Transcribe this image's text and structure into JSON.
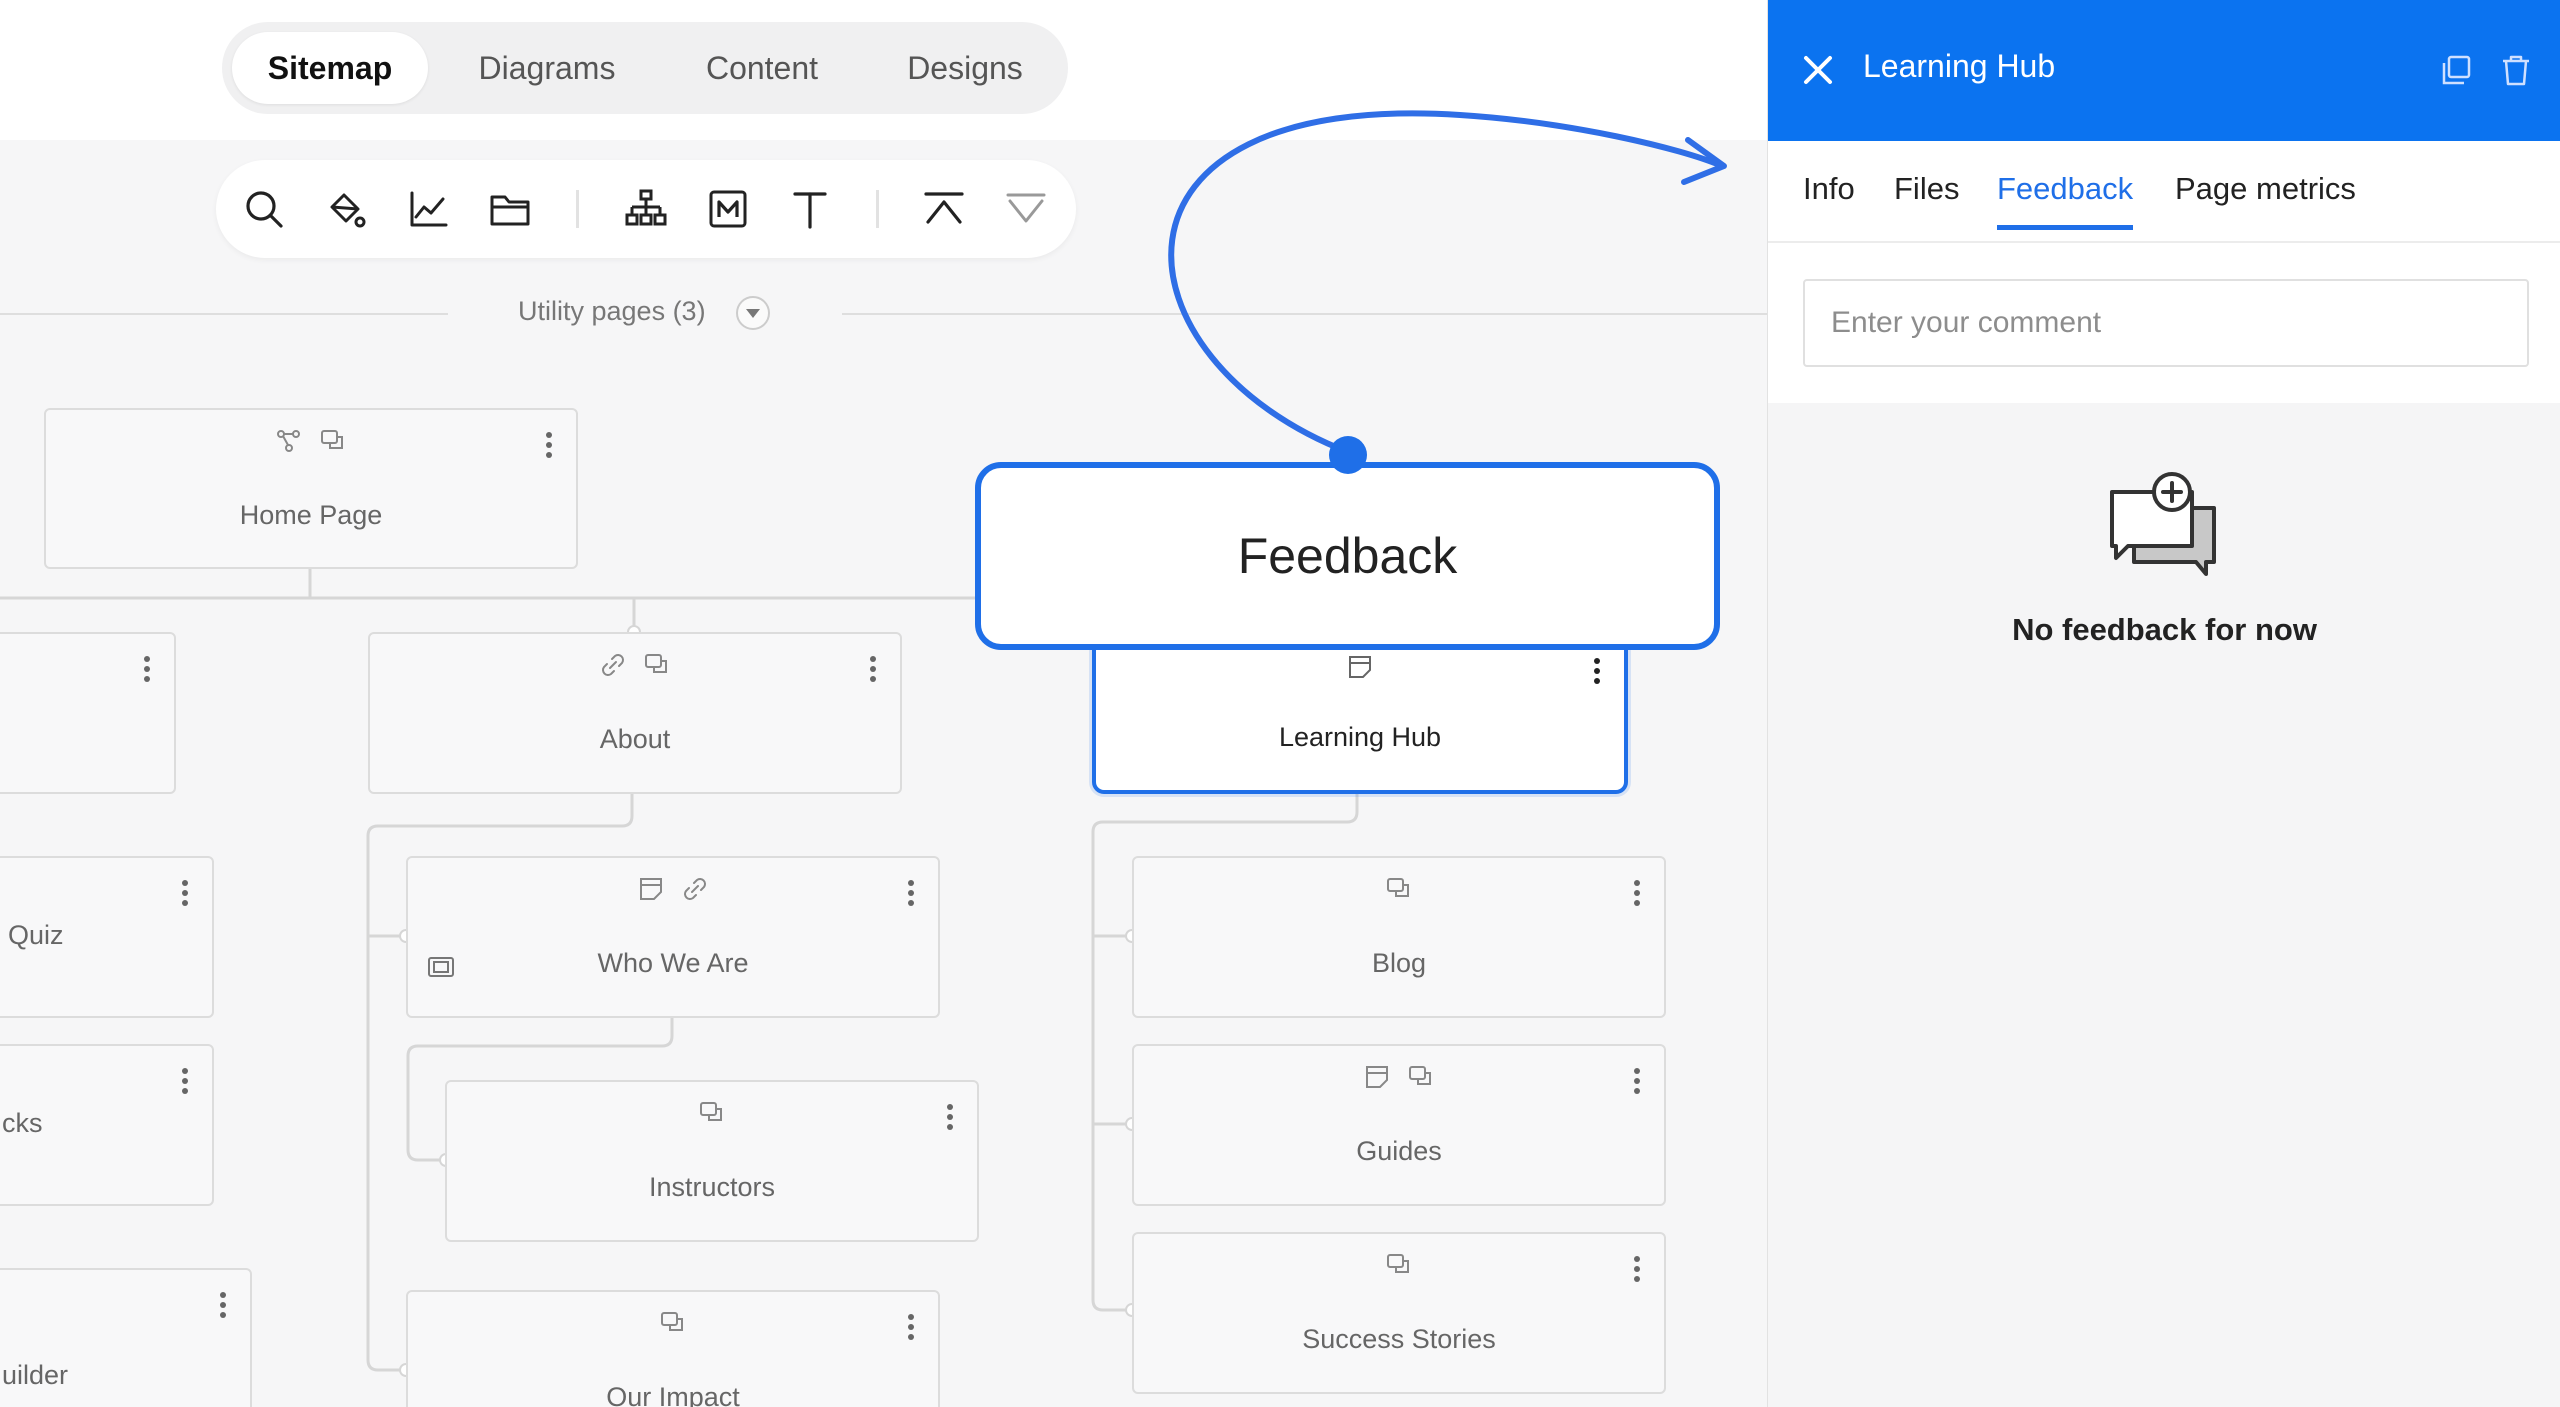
{
  "view_tabs": [
    {
      "label": "Sitemap",
      "active": true
    },
    {
      "label": "Diagrams",
      "active": false
    },
    {
      "label": "Content",
      "active": false
    },
    {
      "label": "Designs",
      "active": false
    }
  ],
  "toolbar": {
    "icons": [
      "search-icon",
      "paint-bucket-icon",
      "line-chart-icon",
      "folder-icon",
      "sitemap-icon",
      "markdown-icon",
      "text-icon",
      "collapse-up-icon",
      "expand-down-icon"
    ]
  },
  "utility": {
    "label": "Utility pages (3)"
  },
  "nodes": {
    "home": "Home Page",
    "about": "About",
    "learning_hub": "Learning Hub",
    "quiz": "Quiz",
    "cks": "cks",
    "builder": "uilder",
    "who_we_are": "Who We Are",
    "instructors": "Instructors",
    "our_impact": "Our Impact",
    "blog": "Blog",
    "guides": "Guides",
    "success_stories": "Success Stories"
  },
  "callout": {
    "label": "Feedback"
  },
  "panel": {
    "title": "Learning Hub",
    "tabs": [
      {
        "label": "Info",
        "active": false
      },
      {
        "label": "Files",
        "active": false
      },
      {
        "label": "Feedback",
        "active": true
      },
      {
        "label": "Page metrics",
        "active": false
      }
    ],
    "comment_placeholder": "Enter your comment",
    "empty_message": "No feedback for now"
  },
  "colors": {
    "accent": "#1f6fe8",
    "header": "#0b73f0"
  }
}
